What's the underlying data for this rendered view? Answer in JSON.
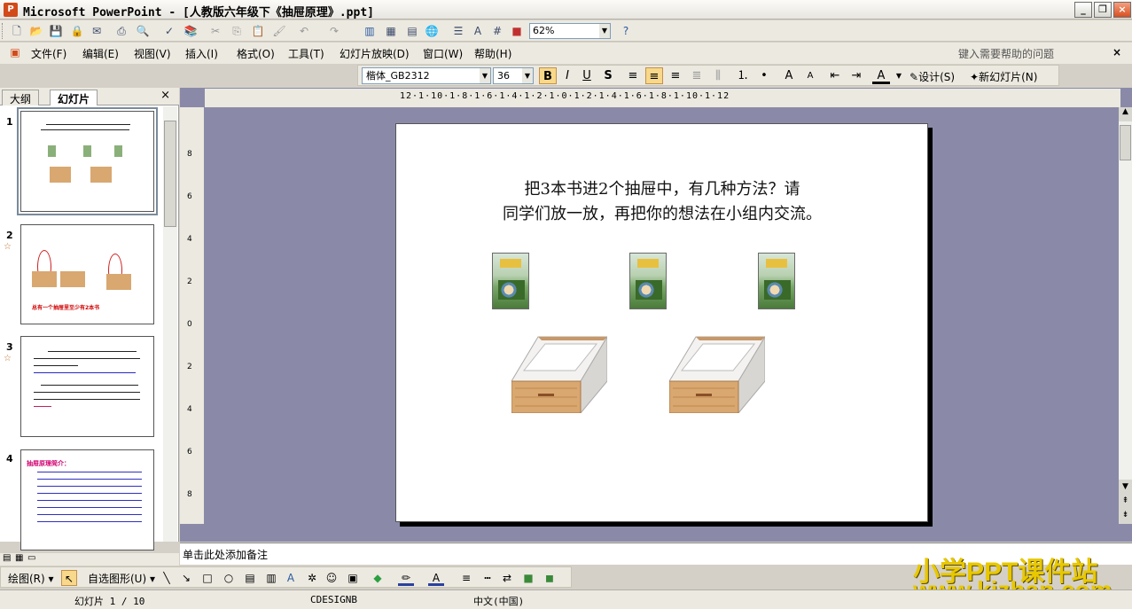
{
  "window": {
    "title": "Microsoft PowerPoint - [人教版六年级下《抽屉原理》.ppt]",
    "app_icon": "powerpoint-icon"
  },
  "standard_toolbar": {
    "zoom": "62%"
  },
  "menubar": {
    "items": [
      "文件(F)",
      "编辑(E)",
      "视图(V)",
      "插入(I)",
      "格式(O)",
      "工具(T)",
      "幻灯片放映(D)",
      "窗口(W)",
      "帮助(H)"
    ],
    "help_placeholder": "键入需要帮助的问题",
    "close_doc": "×"
  },
  "format_toolbar": {
    "font": "楷体_GB2312",
    "size": "36",
    "bold": "B",
    "italic": "I",
    "underline": "U",
    "shadow": "S",
    "design": "设计(S)",
    "new_slide": "新幻灯片(N)"
  },
  "left_pane": {
    "tabs": [
      "大纲",
      "幻灯片"
    ],
    "slides": [
      {
        "number": "1",
        "selected": true
      },
      {
        "number": "2",
        "has_animation": true,
        "caption": "总有一个抽屉里至少有2本书"
      },
      {
        "number": "3",
        "has_animation": true
      },
      {
        "number": "4",
        "heading": "抽屉原理简介："
      }
    ]
  },
  "ruler": {
    "horizontal": "12·1·10·1·8·1·6·1·4·1·2·1·0·1·2·1·4·1·6·1·8·1·10·1·12",
    "vertical": [
      "8",
      "6",
      "4",
      "2",
      "0",
      "2",
      "4",
      "6",
      "8"
    ]
  },
  "slide": {
    "text_line1": "把3本书进2个抽屉中，有几种方法？请",
    "text_line2": "同学们放一放，再把你的想法在小组内交流。"
  },
  "notes": {
    "placeholder": "单击此处添加备注"
  },
  "drawing_toolbar": {
    "draw": "绘图(R)",
    "autoshapes": "自选图形(U)"
  },
  "status": {
    "slide_position": "幻灯片 1 / 10",
    "template": "CDESIGNB",
    "language": "中文(中国)"
  },
  "watermark": {
    "line1": "小学PPT课件站",
    "line2": "www.kjzhan.com"
  },
  "colors": {
    "toolbar_bg": "#ece9e0",
    "workspace_bg": "#8a8aa8",
    "bold_active": "#f8d88a",
    "watermark": "#e8c800"
  }
}
